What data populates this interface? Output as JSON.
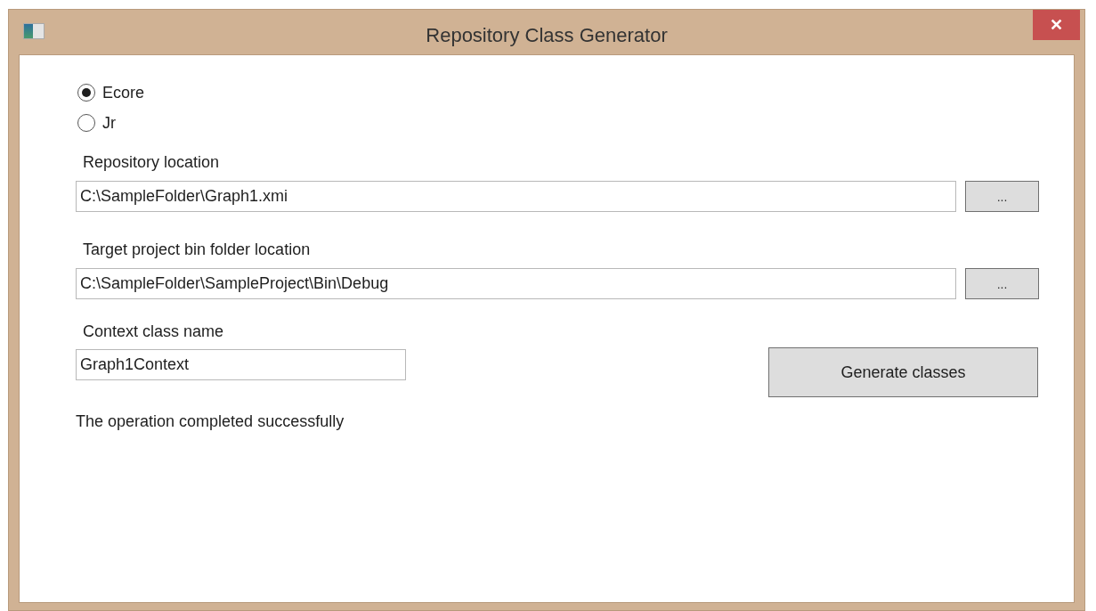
{
  "window": {
    "title": "Repository Class Generator",
    "close": "✕"
  },
  "radios": [
    {
      "label": "Ecore",
      "selected": true
    },
    {
      "label": "Jr",
      "selected": false
    }
  ],
  "repository": {
    "label": "Repository location",
    "value": "C:\\SampleFolder\\Graph1.xmi",
    "browse": "..."
  },
  "target": {
    "label": "Target project bin folder location",
    "value": "C:\\SampleFolder\\SampleProject\\Bin\\Debug",
    "browse": "..."
  },
  "context": {
    "label": "Context class name",
    "value": "Graph1Context"
  },
  "generate_button": "Generate classes",
  "status": "The operation completed successfully"
}
